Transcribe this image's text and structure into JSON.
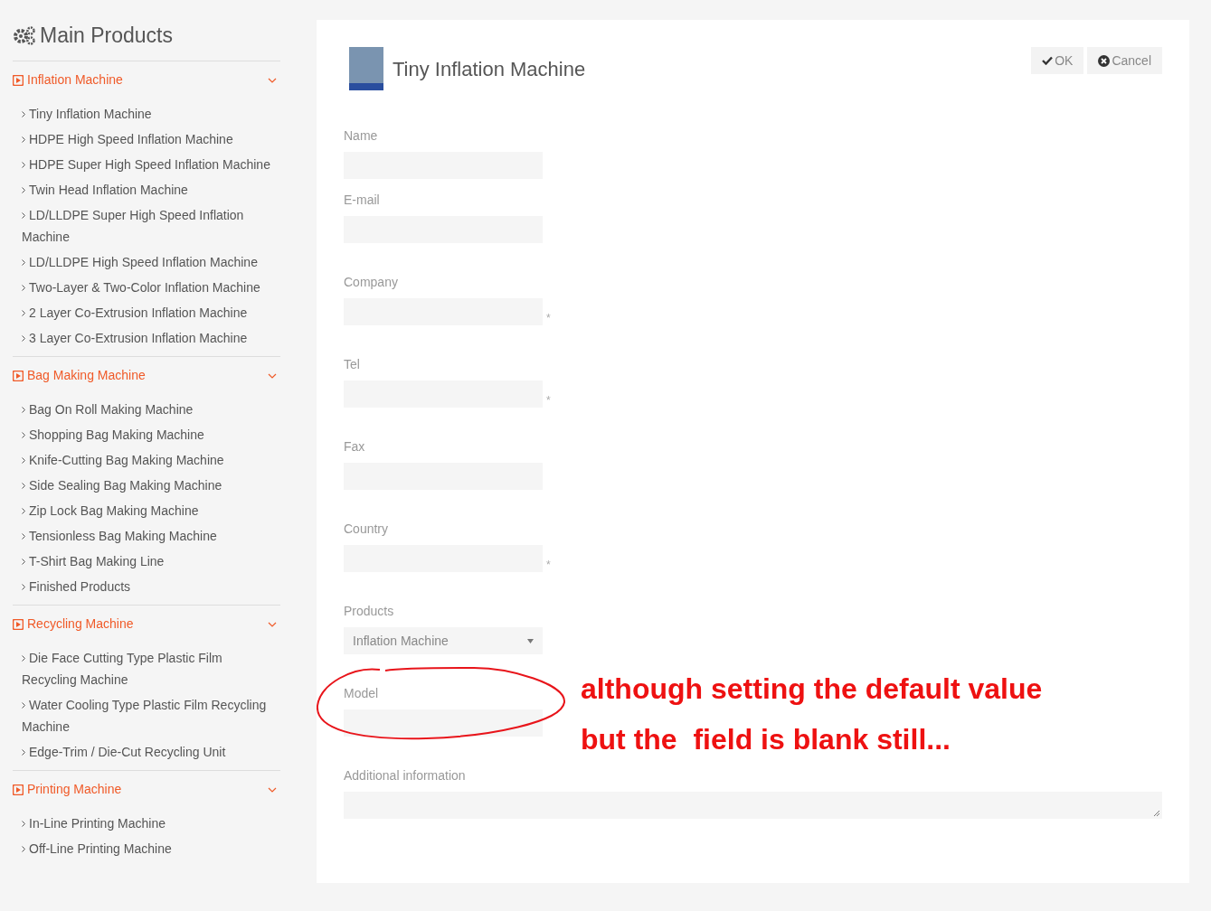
{
  "sidebar": {
    "title": "Main Products",
    "categories": [
      {
        "label": "Inflation Machine",
        "expanded": true,
        "items": [
          "Tiny Inflation Machine",
          "HDPE High Speed Inflation Machine",
          "HDPE Super High Speed Inflation Machine",
          "Twin Head Inflation Machine",
          "LD/LLDPE Super High Speed Inflation Machine",
          "LD/LLDPE High Speed Inflation Machine",
          "Two-Layer & Two-Color Inflation Machine",
          "2 Layer Co-Extrusion Inflation Machine",
          "3 Layer Co-Extrusion Inflation Machine"
        ]
      },
      {
        "label": "Bag Making Machine",
        "expanded": true,
        "items": [
          "Bag On Roll Making Machine",
          "Shopping Bag Making Machine",
          "Knife-Cutting Bag Making Machine",
          "Side Sealing Bag Making Machine",
          "Zip Lock Bag Making Machine",
          "Tensionless Bag Making Machine",
          "T-Shirt Bag Making Line",
          "Finished Products"
        ]
      },
      {
        "label": "Recycling Machine",
        "expanded": true,
        "items": [
          "Die Face Cutting Type Plastic Film Recycling Machine",
          "Water Cooling Type Plastic Film Recycling Machine",
          "Edge-Trim / Die-Cut Recycling Unit"
        ]
      },
      {
        "label": "Printing Machine",
        "expanded": true,
        "items": [
          "In-Line Printing Machine",
          "Off-Line Printing Machine"
        ]
      }
    ]
  },
  "form": {
    "title": "Tiny Inflation Machine",
    "buttons": [
      {
        "label": "OK",
        "kind": "ok"
      },
      {
        "label": "Cancel",
        "kind": "cancel"
      }
    ],
    "fields": [
      {
        "label": "Name",
        "kind": "text"
      },
      {
        "label": "E-mail",
        "kind": "text"
      },
      {
        "label": "Company",
        "kind": "text",
        "required": "*"
      },
      {
        "label": "Tel",
        "kind": "text",
        "required": "*"
      },
      {
        "label": "Fax",
        "kind": "text"
      },
      {
        "label": "Country",
        "kind": "text",
        "required": "*"
      },
      {
        "label": "Products",
        "kind": "select",
        "value": "Inflation Machine"
      },
      {
        "label": "Model",
        "kind": "text",
        "circled": true
      },
      {
        "label": "Additional information",
        "kind": "textarea"
      }
    ]
  },
  "annotation": {
    "lines": [
      "although setting the default value",
      "but the  field is blank still..."
    ]
  }
}
